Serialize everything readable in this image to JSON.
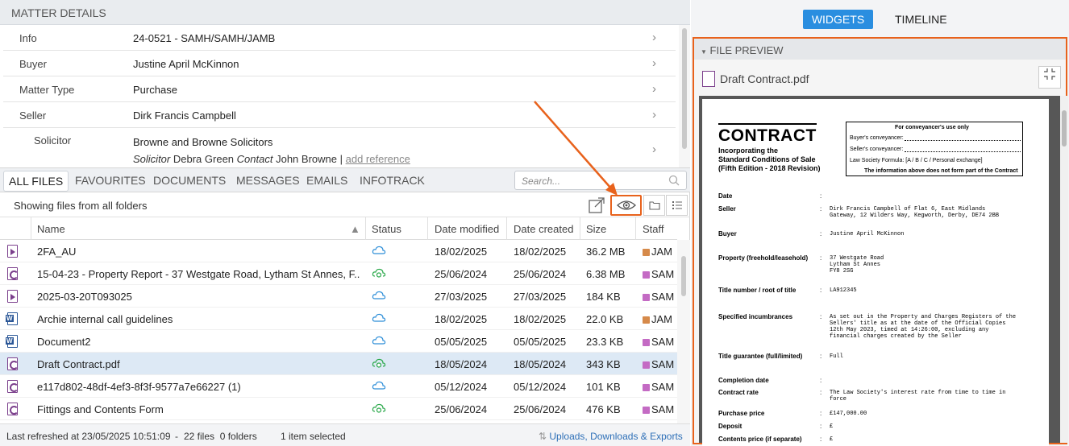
{
  "matter_details": {
    "title": "MATTER DETAILS",
    "rows": [
      {
        "label": "Info",
        "value": "24-0521 - SAMH/SAMH/JAMB"
      },
      {
        "label": "Buyer",
        "value": "Justine April McKinnon"
      },
      {
        "label": "Matter Type",
        "value": "Purchase"
      },
      {
        "label": "Seller",
        "value": "Dirk Francis Campbell"
      }
    ],
    "solicitor": {
      "label": "Solicitor",
      "value": "Browne and Browne Solicitors",
      "solicitor_label": "Solicitor",
      "solicitor_name": "Debra Green",
      "contact_label": "Contact",
      "contact_name": "John Browne",
      "separator": "|",
      "add_reference": "add reference"
    }
  },
  "tabs": [
    "ALL FILES",
    "FAVOURITES",
    "DOCUMENTS",
    "MESSAGES",
    "EMAILS",
    "INFOTRACK"
  ],
  "search": {
    "placeholder": "Search..."
  },
  "toolbar": {
    "info": "Showing files from all folders"
  },
  "columns": {
    "name": "Name",
    "status": "Status",
    "modified": "Date modified",
    "created": "Date created",
    "size": "Size",
    "staff": "Staff"
  },
  "files": [
    {
      "name": "2FA_AU",
      "icon": "video-icon",
      "status": "cloud",
      "modified": "18/02/2025",
      "created": "18/02/2025",
      "size": "36.2 MB",
      "staff": "JAM",
      "staff_color": "#d68a4a"
    },
    {
      "name": "15-04-23 - Property Report - 37 Westgate Road, Lytham St Annes, F...",
      "icon": "pdf-icon",
      "status": "synced",
      "modified": "25/06/2024",
      "created": "25/06/2024",
      "size": "6.38 MB",
      "staff": "SAM",
      "staff_color": "#c46bc4"
    },
    {
      "name": "2025-03-20T093025",
      "icon": "video-icon",
      "status": "cloud",
      "modified": "27/03/2025",
      "created": "27/03/2025",
      "size": "184 KB",
      "staff": "SAM",
      "staff_color": "#c46bc4"
    },
    {
      "name": "Archie internal call guidelines",
      "icon": "word-icon",
      "status": "cloud",
      "modified": "18/02/2025",
      "created": "18/02/2025",
      "size": "22.0 KB",
      "staff": "JAM",
      "staff_color": "#d68a4a"
    },
    {
      "name": "Document2",
      "icon": "word-icon",
      "status": "cloud",
      "modified": "05/05/2025",
      "created": "05/05/2025",
      "size": "23.3 KB",
      "staff": "SAM",
      "staff_color": "#c46bc4"
    },
    {
      "name": "Draft Contract.pdf",
      "icon": "pdf-icon",
      "status": "synced",
      "modified": "18/05/2024",
      "created": "18/05/2024",
      "size": "343 KB",
      "staff": "SAM",
      "staff_color": "#c46bc4",
      "selected": true
    },
    {
      "name": "e117d802-48df-4ef3-8f3f-9577a7e66227 (1)",
      "icon": "pdf-icon",
      "status": "cloud",
      "modified": "05/12/2024",
      "created": "05/12/2024",
      "size": "101 KB",
      "staff": "SAM",
      "staff_color": "#c46bc4"
    },
    {
      "name": "Fittings and Contents Form",
      "icon": "pdf-icon",
      "status": "synced",
      "modified": "25/06/2024",
      "created": "25/06/2024",
      "size": "476 KB",
      "staff": "SAM",
      "staff_color": "#c46bc4"
    }
  ],
  "statusbar": {
    "refreshed": "Last refreshed at 23/05/2025 10:51:09",
    "dash": "-",
    "counts": "22 files  0 folders",
    "selection": "1 item selected",
    "uploads": "Uploads, Downloads & Exports"
  },
  "right": {
    "widgets": "WIDGETS",
    "timeline": "TIMELINE",
    "panel_title": "FILE PREVIEW",
    "file_name": "Draft Contract.pdf"
  },
  "contract": {
    "title": "CONTRACT",
    "subtitle": [
      "Incorporating the",
      "Standard Conditions of Sale",
      "(Fifth Edition - 2018 Revision)"
    ],
    "box_title": "For conveyancer's use only",
    "box_lines": [
      "Buyer's conveyancer:",
      "Seller's conveyancer:",
      "Law Society Formula: [A / B / C / Personal exchange]"
    ],
    "box_note": "The information above does not form part of the Contract",
    "fields": [
      {
        "label": "Date",
        "value": ""
      },
      {
        "label": "Seller",
        "value": "Dirk Francis Campbell of Flat 6, East Midlands\nGateway, 12 Wilders Way, Kegworth, Derby, DE74 2BB"
      },
      {
        "label": "Buyer",
        "value": "Justine April McKinnon"
      },
      {
        "label": "Property (freehold/leasehold)",
        "value": "37 Westgate Road\nLytham St Annes\nFY8 2SG"
      },
      {
        "label": "Title number / root of title",
        "value": "LA912345"
      },
      {
        "label": "Specified incumbrances",
        "value": "As set out in the Property and Charges Registers of the\nSellers' title as at the date of the Official Copies\n12th May 2023, timed at 14:26:00, excluding any\nfinancial charges created by the Seller"
      },
      {
        "label": "Title guarantee (full/limited)",
        "value": "Full"
      },
      {
        "label": "Completion date",
        "value": ""
      },
      {
        "label": "Contract rate",
        "value": "The Law Society's interest rate from time to time in\nforce"
      },
      {
        "label": "Purchase price",
        "value": "£147,000.00"
      },
      {
        "label": "Deposit",
        "value": "£"
      },
      {
        "label": "Contents price (if separate)",
        "value": "£"
      }
    ]
  }
}
